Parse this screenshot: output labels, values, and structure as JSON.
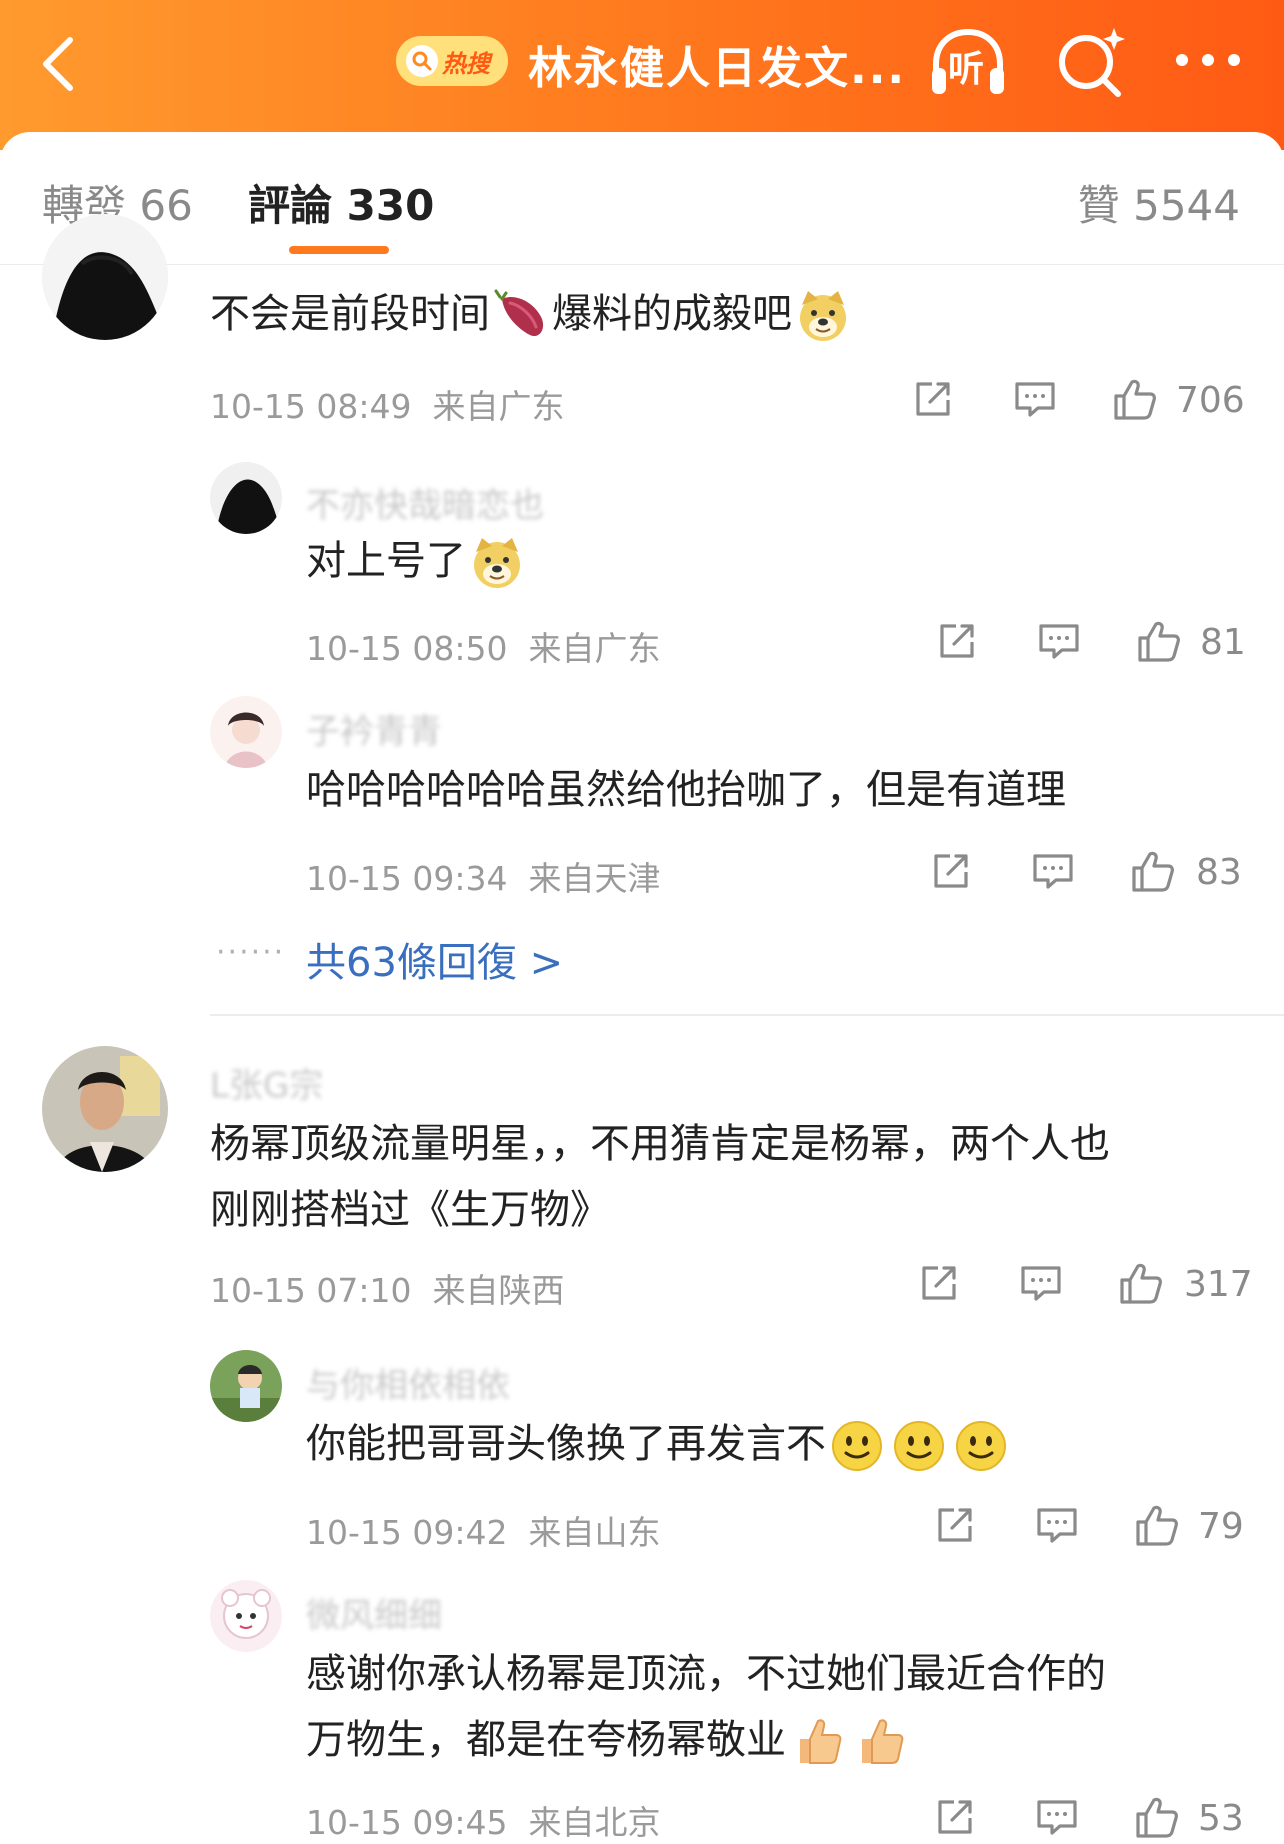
{
  "header": {
    "hot_search_tag": "热搜",
    "title": "林永健人日发文...",
    "listen_label": "听"
  },
  "tabs": {
    "repost": "轉發 66",
    "comment": "評論 330",
    "like": "贊 5544"
  },
  "comments": [
    {
      "name": "",
      "text_before": "不会是前段时间",
      "text_after": "爆料的成毅吧",
      "time": "10-15 08:49",
      "location": "来自广东",
      "likes": "706",
      "replies": [
        {
          "name": "不亦快哉暗恋也",
          "text": "对上号了",
          "time": "10-15 08:50",
          "location": "来自广东",
          "likes": "81"
        },
        {
          "name": "子衿青青",
          "text": "哈哈哈哈哈哈虽然给他抬咖了，但是有道理",
          "time": "10-15 09:34",
          "location": "来自天津",
          "likes": "83"
        }
      ],
      "more_replies": "共63條回復 >"
    },
    {
      "name": "L张G宗",
      "text_line1": "杨幂顶级流量明星，，不用猜肯定是杨幂，两个人也",
      "text_line2": "刚刚搭档过《生万物》",
      "time": "10-15 07:10",
      "location": "来自陕西",
      "likes": "317",
      "replies": [
        {
          "name": "与你相依相依",
          "text": "你能把哥哥头像换了再发言不",
          "time": "10-15 09:42",
          "location": "来自山东",
          "likes": "79"
        },
        {
          "name": "微风细细",
          "text_line1": "感谢你承认杨幂是顶流，不过她们最近合作的",
          "text_line2": "万物生，都是在夸杨幂敬业",
          "time": "10-15 09:45",
          "location": "来自北京",
          "likes": "53"
        }
      ]
    }
  ],
  "colors": {
    "header_gradient_start": "#ff9a2e",
    "header_gradient_end": "#ff5a14",
    "tab_indicator": "#ff7a1e",
    "link_blue": "#3a6fc0",
    "meta_gray": "#9a9a9a"
  },
  "icons": [
    "back-arrow-icon",
    "search-icon",
    "headphones-icon",
    "sparkle-search-icon",
    "more-dots-icon",
    "share-icon",
    "comment-icon",
    "thumbs-up-icon",
    "sweet-potato-emoji",
    "doge-emoji",
    "smile-emoji",
    "thumbs-up-emoji"
  ]
}
